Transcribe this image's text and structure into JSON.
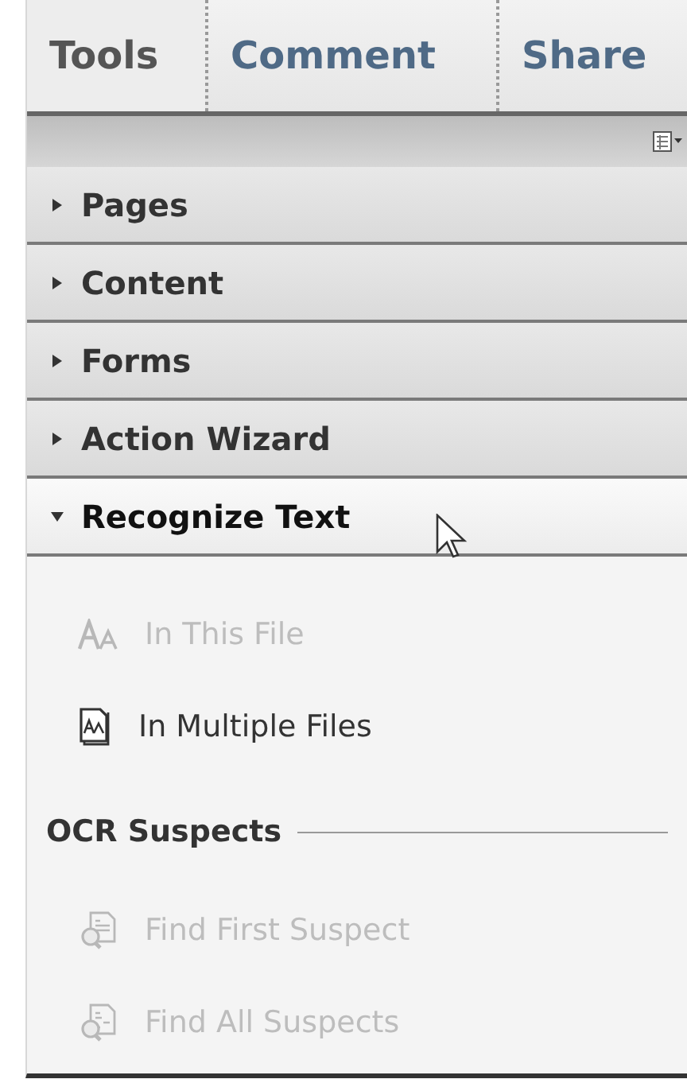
{
  "tabs": [
    {
      "label": "Tools",
      "selected": true
    },
    {
      "label": "Comment",
      "selected": false
    },
    {
      "label": "Share",
      "selected": false
    }
  ],
  "panels": [
    {
      "title": "Pages",
      "expanded": false
    },
    {
      "title": "Content",
      "expanded": false
    },
    {
      "title": "Forms",
      "expanded": false
    },
    {
      "title": "Action Wizard",
      "expanded": false
    },
    {
      "title": "Recognize Text",
      "expanded": true,
      "items": [
        {
          "kind": "text-size",
          "label": "In This File",
          "disabled": true
        },
        {
          "kind": "text-document",
          "label": "In Multiple Files",
          "disabled": false
        },
        {
          "kind": "heading",
          "label": "OCR Suspects"
        },
        {
          "kind": "suspect",
          "label": "Find First Suspect",
          "disabled": true
        },
        {
          "kind": "suspect-all",
          "label": "Find All Suspects",
          "disabled": true
        }
      ]
    }
  ]
}
